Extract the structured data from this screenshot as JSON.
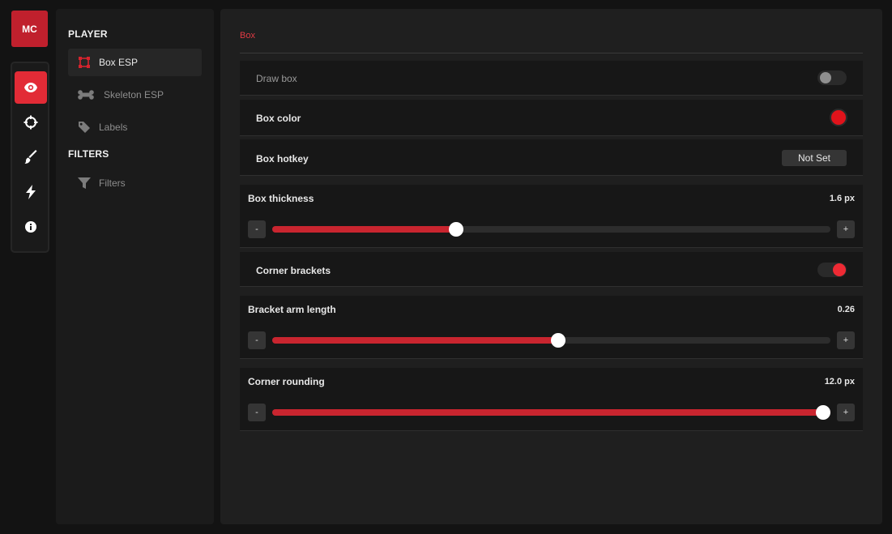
{
  "brand": {
    "initials": "MC",
    "color": "#c0202d"
  },
  "rail": {
    "items": [
      {
        "icon": "eye-icon",
        "active": true
      },
      {
        "icon": "crosshair-icon",
        "active": false
      },
      {
        "icon": "brush-icon",
        "active": false
      },
      {
        "icon": "lightning-icon",
        "active": false
      },
      {
        "icon": "info-icon",
        "active": false
      }
    ]
  },
  "subnav": {
    "player_heading": "PLAYER",
    "filters_heading": "FILTERS",
    "items": [
      {
        "label": "Box ESP",
        "icon": "box-icon",
        "active": true
      },
      {
        "label": "Skeleton ESP",
        "icon": "bone-icon",
        "active": false
      },
      {
        "label": "Labels",
        "icon": "tag-icon",
        "active": false
      },
      {
        "label": "Filters",
        "icon": "funnel-icon",
        "active": false
      }
    ]
  },
  "main": {
    "title": "Box",
    "draw_box": {
      "label": "Draw box",
      "enabled": false
    },
    "box_color": {
      "label": "Box color",
      "color": "#e0131b"
    },
    "box_hotkey": {
      "label": "Box hotkey",
      "value": "Not Set"
    },
    "box_thickness": {
      "label": "Box thickness",
      "value_text": "1.6 px",
      "fraction": 0.33
    },
    "corner_brackets": {
      "label": "Corner brackets",
      "enabled": true
    },
    "bracket_arm_length": {
      "label": "Bracket arm length",
      "value_text": "0.26",
      "fraction": 0.513
    },
    "corner_rounding": {
      "label": "Corner rounding",
      "value_text": "12.0 px",
      "fraction": 1.0
    },
    "minus_label": "-",
    "plus_label": "+"
  },
  "colors": {
    "accent": "#e22b36",
    "slider_fill": "#c9252f"
  }
}
